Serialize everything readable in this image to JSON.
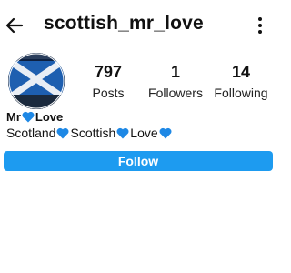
{
  "header": {
    "username": "scottish_mr_love",
    "back_icon": "arrow-left-icon",
    "more_icon": "more-vertical-icon"
  },
  "profile": {
    "avatar_description_icon": "scotland-flag-avatar",
    "display_name": "Mr",
    "display_name_suffix": "Love",
    "bio_parts": [
      "Scotland",
      "Scottish",
      "Love"
    ],
    "heart_color": "#1e88e5"
  },
  "stats": {
    "posts": {
      "value": "797",
      "label": "Posts"
    },
    "followers": {
      "value": "1",
      "label": "Followers"
    },
    "following": {
      "value": "14",
      "label": "Following"
    }
  },
  "actions": {
    "follow_label": "Follow",
    "follow_color": "#1d9bf0"
  }
}
